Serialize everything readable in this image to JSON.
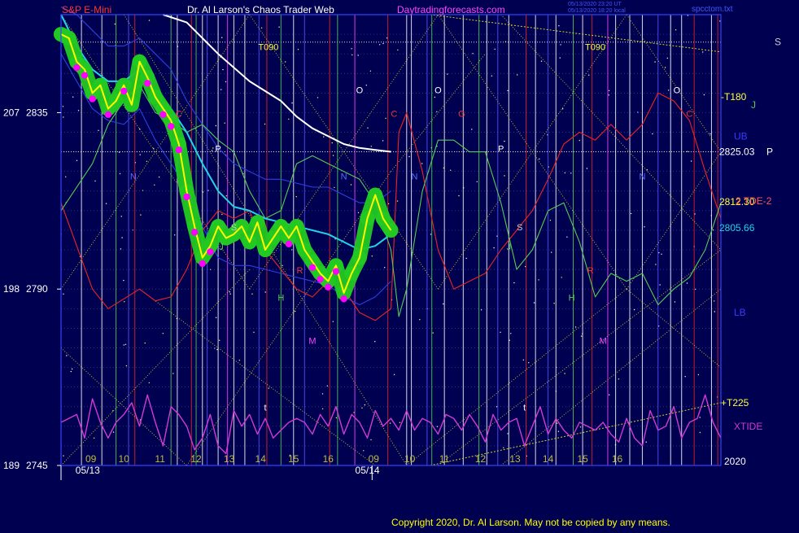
{
  "header": {
    "title_left": "S&P E-Mini",
    "title_center": "Dr. Al Larson's Chaos Trader Web",
    "title_site": "Daytradingforecasts.com",
    "timestamp1": "05/13/2020 23:20 UT",
    "timestamp2": "05/13/2020 18:20 local",
    "file": "spcctom.txt"
  },
  "footer": {
    "copyright": "Copyright 2020, Dr. Al Larson. May not be copied by any means."
  },
  "colors": {
    "background": "#000050",
    "price": "#ffff00",
    "glow": "#22c922",
    "dots": "#ff00ff",
    "ma_cyan": "#22d3e6",
    "ma_white": "#ffffff",
    "red_line": "#ee2222",
    "green_line": "#55cc55",
    "blue_line": "#3a3aff",
    "xtide": "#d23ad2",
    "frame": "#3344ff"
  },
  "chart_data": {
    "type": "line",
    "title": "S&P E-Mini",
    "y_axis_left": [
      {
        "label": "207",
        "value": "2835"
      },
      {
        "label": "198",
        "value": "2790"
      },
      {
        "label": "189",
        "value": "2745"
      }
    ],
    "ylim": [
      2745,
      2860
    ],
    "x_dates": [
      "05/13",
      "05/14"
    ],
    "hours": [
      "09",
      "10",
      "11",
      "12",
      "13",
      "14",
      "15",
      "16",
      "09",
      "10",
      "11",
      "12",
      "13",
      "14",
      "15",
      "16"
    ],
    "right_labels": [
      {
        "text": "-T180",
        "price": 2839
      },
      {
        "text": "S",
        "price": 2853
      },
      {
        "text": "J",
        "price": 2837
      },
      {
        "text": "UB",
        "price": 2829
      },
      {
        "text": "2825.03",
        "price": 2825.03
      },
      {
        "text": "P",
        "price": 2825.03
      },
      {
        "text": "2812.30",
        "price": 2812.3
      },
      {
        "text": "2 TDE-2",
        "price": 2812.5
      },
      {
        "text": "2805.66",
        "price": 2805.66
      },
      {
        "text": "LB",
        "price": 2784
      },
      {
        "text": "+T225",
        "price": 2761
      },
      {
        "text": "XTIDE",
        "price": 2755
      },
      {
        "text": "2020",
        "price": 2746
      }
    ],
    "planet_labels": [
      {
        "text": "T090",
        "x": 13.2,
        "price": 2851
      },
      {
        "text": "T090",
        "x": 34.0,
        "price": 2851
      },
      {
        "text": "O",
        "x": 19.0,
        "price": 2840
      },
      {
        "text": "O",
        "x": 24.0,
        "price": 2840
      },
      {
        "text": "O",
        "x": 39.2,
        "price": 2840
      },
      {
        "text": "C",
        "x": 7.5,
        "price": 2834
      },
      {
        "text": "C",
        "x": 21.2,
        "price": 2834
      },
      {
        "text": "G",
        "x": 25.5,
        "price": 2834
      },
      {
        "text": "C",
        "x": 40.0,
        "price": 2834
      },
      {
        "text": "P",
        "x": 10.0,
        "price": 2825
      },
      {
        "text": "P",
        "x": 28.0,
        "price": 2825
      },
      {
        "text": "N",
        "x": 4.6,
        "price": 2818
      },
      {
        "text": "N",
        "x": 18.0,
        "price": 2818
      },
      {
        "text": "N",
        "x": 22.5,
        "price": 2818
      },
      {
        "text": "N",
        "x": 37.0,
        "price": 2818
      },
      {
        "text": "S",
        "x": 11.0,
        "price": 2805
      },
      {
        "text": "S",
        "x": 29.2,
        "price": 2805
      },
      {
        "text": "J",
        "x": 10.2,
        "price": 2800
      },
      {
        "text": "J",
        "x": 28.5,
        "price": 2800
      },
      {
        "text": "R",
        "x": 15.2,
        "price": 2794
      },
      {
        "text": "R",
        "x": 33.7,
        "price": 2794
      },
      {
        "text": "H",
        "x": 14.0,
        "price": 2787
      },
      {
        "text": "H",
        "x": 32.5,
        "price": 2787
      },
      {
        "text": "M",
        "x": 16.0,
        "price": 2776
      },
      {
        "text": "M",
        "x": 34.5,
        "price": 2776
      },
      {
        "text": "t",
        "x": 13.0,
        "price": 2759
      },
      {
        "text": "t",
        "x": 29.5,
        "price": 2759
      }
    ],
    "series": [
      {
        "name": "price",
        "x": [
          0,
          0.5,
          1,
          1.5,
          2,
          2.5,
          3,
          3.5,
          4,
          4.5,
          5,
          5.5,
          6,
          6.5,
          7,
          7.5,
          8,
          8.5,
          9,
          9.5,
          10,
          10.5,
          11,
          11.5,
          12,
          12.5,
          13,
          13.5,
          14,
          14.5,
          15,
          15.5,
          16,
          16.5,
          17,
          17.5,
          18,
          18.5,
          19,
          19.5,
          20,
          20.5,
          21
        ],
        "values": [
          2855,
          2854,
          2848,
          2846,
          2840,
          2842,
          2836,
          2838,
          2842,
          2837,
          2848,
          2844,
          2839,
          2836,
          2833,
          2827,
          2815,
          2806,
          2798,
          2801,
          2806,
          2803,
          2804,
          2806,
          2802,
          2807,
          2800,
          2803,
          2806,
          2803,
          2806,
          2800,
          2797,
          2794,
          2792,
          2796,
          2789,
          2794,
          2798,
          2808,
          2814,
          2808,
          2805
        ]
      },
      {
        "name": "moving average",
        "x": [
          0,
          1,
          2,
          3,
          4,
          5,
          6,
          7,
          8,
          9,
          10,
          11,
          12,
          13,
          14,
          15,
          16,
          17,
          18,
          19,
          20,
          21
        ],
        "values": [
          2860,
          2852,
          2846,
          2843,
          2843,
          2846,
          2840,
          2836,
          2830,
          2822,
          2815,
          2811,
          2810,
          2808,
          2807,
          2806,
          2805,
          2804,
          2802,
          2800,
          2801,
          2804
        ]
      },
      {
        "name": "200 average",
        "x": [
          6.5,
          8,
          10,
          12,
          14,
          15,
          16,
          18,
          19,
          20,
          21
        ],
        "values": [
          2860,
          2858,
          2850,
          2843,
          2838,
          2834,
          2831,
          2827,
          2826,
          2825.5,
          2825.03
        ]
      },
      {
        "name": "red forecast",
        "x": [
          0,
          2,
          3,
          5,
          6,
          7,
          8,
          9,
          10,
          11,
          12,
          13,
          14,
          15,
          16,
          17,
          18,
          19,
          20,
          21,
          21.5,
          22,
          23,
          24,
          25,
          26,
          27,
          28,
          29,
          30,
          31,
          32,
          33,
          34,
          35,
          36,
          37,
          38,
          39,
          40,
          41,
          42
        ],
        "values": [
          2812,
          2790,
          2785,
          2790,
          2787,
          2788,
          2795,
          2805,
          2810,
          2808,
          2810,
          2800,
          2795,
          2790,
          2788,
          2792,
          2790,
          2784,
          2782,
          2785,
          2830,
          2835,
          2820,
          2800,
          2790,
          2792,
          2794,
          2800,
          2805,
          2810,
          2818,
          2827,
          2830,
          2828,
          2832,
          2828,
          2832,
          2840,
          2838,
          2833,
          2820,
          2808
        ]
      },
      {
        "name": "green forecast",
        "x": [
          0,
          2,
          3,
          4,
          5,
          6,
          7,
          8,
          9,
          10,
          11,
          12,
          13,
          14,
          15,
          16,
          17,
          18,
          19,
          20,
          21,
          21.5,
          22,
          23,
          24,
          25,
          26,
          27,
          28,
          29,
          30,
          31,
          32,
          33,
          34,
          35,
          36,
          37,
          38,
          39,
          40,
          41,
          42
        ],
        "values": [
          2810,
          2822,
          2832,
          2838,
          2842,
          2835,
          2833,
          2830,
          2832,
          2828,
          2825,
          2815,
          2808,
          2810,
          2822,
          2824,
          2822,
          2820,
          2818,
          2812,
          2800,
          2783,
          2790,
          2815,
          2828,
          2828,
          2825,
          2825,
          2812,
          2795,
          2800,
          2810,
          2812,
          2802,
          2788,
          2794,
          2792,
          2794,
          2786,
          2790,
          2793,
          2800,
          2812
        ]
      },
      {
        "name": "upper band",
        "x": [
          0,
          1,
          2,
          3,
          4,
          5,
          6,
          7,
          8,
          9,
          10,
          11,
          12,
          13,
          14,
          15,
          16,
          17,
          18,
          19,
          20,
          21
        ],
        "values": [
          2862,
          2860,
          2856,
          2852,
          2852,
          2854,
          2850,
          2846,
          2838,
          2832,
          2826,
          2822,
          2820,
          2818,
          2818,
          2817,
          2816,
          2816,
          2814,
          2812,
          2812,
          2815
        ]
      },
      {
        "name": "lower band",
        "x": [
          0,
          1,
          2,
          3,
          4,
          5,
          6,
          7,
          8,
          9,
          10,
          11,
          12,
          13,
          14,
          15,
          16,
          17,
          18,
          19,
          20,
          21
        ],
        "values": [
          2850,
          2843,
          2836,
          2833,
          2832,
          2836,
          2828,
          2822,
          2816,
          2806,
          2798,
          2796,
          2796,
          2795,
          2794,
          2793,
          2792,
          2791,
          2788,
          2786,
          2788,
          2792
        ]
      },
      {
        "name": "XTIDE",
        "x": [
          0,
          1,
          1.5,
          2,
          2.5,
          3,
          3.5,
          4,
          4.5,
          5,
          5.5,
          6,
          6.5,
          7,
          7.5,
          8,
          8.5,
          9,
          9.5,
          10,
          10.5,
          11,
          11.5,
          12,
          12.5,
          13,
          13.5,
          14,
          14.5,
          15,
          15.5,
          16,
          16.5,
          17,
          17.5,
          18,
          18.5,
          19,
          19.5,
          20,
          20.5,
          21,
          21.5,
          22,
          22.5,
          23,
          23.5,
          24,
          24.5,
          25,
          25.5,
          26,
          26.5,
          27,
          27.5,
          28,
          28.5,
          29,
          29.5,
          30,
          30.5,
          31,
          31.5,
          32,
          32.5,
          33,
          33.5,
          34,
          34.5,
          35,
          35.5,
          36,
          36.5,
          37,
          37.5,
          38,
          38.5,
          39,
          39.5,
          40,
          40.5,
          41,
          41.5,
          42
        ],
        "values": [
          2756,
          2758,
          2752,
          2762,
          2756,
          2752,
          2756,
          2758,
          2761,
          2755,
          2763,
          2756,
          2750,
          2760,
          2758,
          2755,
          2749,
          2752,
          2758,
          2750,
          2748,
          2759,
          2755,
          2758,
          2753,
          2757,
          2752,
          2754,
          2756,
          2757,
          2756,
          2753,
          2758,
          2755,
          2760,
          2753,
          2758,
          2756,
          2752,
          2759,
          2755,
          2757,
          2754,
          2759,
          2754,
          2757,
          2756,
          2753,
          2758,
          2757,
          2754,
          2758,
          2755,
          2751,
          2758,
          2754,
          2756,
          2757,
          2750,
          2755,
          2760,
          2753,
          2757,
          2754,
          2752,
          2756,
          2755,
          2754,
          2756,
          2753,
          2751,
          2757,
          2752,
          2750,
          2759,
          2754,
          2755,
          2760,
          2752,
          2756,
          2757,
          2763,
          2756,
          2752
        ]
      }
    ]
  }
}
